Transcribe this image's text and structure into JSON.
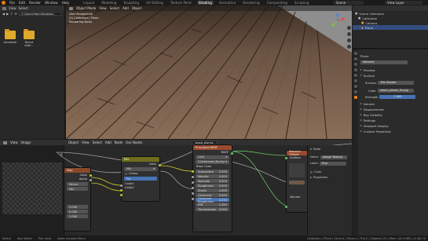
{
  "topbar": {
    "menus": [
      "File",
      "Edit",
      "Render",
      "Window",
      "Help"
    ],
    "workspaces": [
      "Layout",
      "Modeling",
      "Sculpting",
      "UV Editing",
      "Texture Paint",
      "Shading",
      "Animation",
      "Rendering",
      "Compositing",
      "Scripting"
    ],
    "active_workspace": "Shading",
    "scene": "Scene",
    "view_layer": "View Layer"
  },
  "filebrowser": {
    "menus": [
      "View",
      "Select"
    ],
    "path": "C:\\Users\\Yann\\Desktop\\",
    "folders": [
      "Autodesk",
      "Blend Addl..."
    ]
  },
  "viewport": {
    "menus": [
      "Object Mode",
      "View",
      "Select",
      "Add",
      "Object"
    ],
    "overlay_line1": "User Perspective",
    "overlay_line2": "(1) Collection | Plane",
    "overlay_line3": "Rendering Done"
  },
  "outliner": {
    "items": [
      "Scene Collection",
      "Collection",
      "Camera",
      "Plane"
    ]
  },
  "properties": {
    "breadcrumb": "Plane",
    "material_name": "Material",
    "sections": [
      "Preview",
      "Surface"
    ],
    "surface_label": "Surface",
    "surface_value": "Mix Shader",
    "color_label": "Color",
    "color_value": "wood_planks_0x.jpg",
    "strength_label": "Strength",
    "strength_value": "1.000",
    "collapsed": [
      "Volume",
      "Displacement",
      "Ray Visibility",
      "Settings",
      "Viewport Display",
      "Custom Properties"
    ]
  },
  "nodeeditor": {
    "menus": [
      "Object",
      "View",
      "Select",
      "Add",
      "Node",
      "Use Nodes"
    ],
    "material_field": "wood_planks",
    "img_menus": [
      "View",
      "Image"
    ],
    "img_values": [
      "2.000",
      "0.000",
      "1.000"
    ],
    "nodes": {
      "mix": {
        "title": "Mix",
        "out": "Color",
        "blend": "Mix",
        "clamp": "Clamp",
        "fac": "Fac",
        "in1": "Color1",
        "in2": "Color2"
      },
      "texture": {
        "title": "Texture",
        "out1": "Color",
        "out2": "Alpha"
      },
      "principled": {
        "title": "Principled BSDF",
        "out": "BSDF",
        "dist": "GGX",
        "sss": "Christensen-Burley",
        "rows": [
          {
            "label": "Base Color",
            "value": ""
          },
          {
            "label": "Subsurface",
            "value": "0.000"
          },
          {
            "label": "Metallic",
            "value": "0.000"
          },
          {
            "label": "Specular",
            "value": "0.500"
          },
          {
            "label": "Roughness",
            "value": "0.500"
          },
          {
            "label": "Sheen",
            "value": "0.000"
          },
          {
            "label": "Clearcoat",
            "value": "0.000"
          },
          {
            "label": "Clearcoat Roughness",
            "value": "0.030"
          },
          {
            "label": "IOR",
            "value": "1.450"
          },
          {
            "label": "Transmission",
            "value": "0.000"
          }
        ]
      },
      "output": {
        "title": "Material Output",
        "in1": "Surface",
        "in2": "Volume"
      },
      "partial": {
        "title": "Map",
        "rows": [
          "Vector",
          "Vec",
          "Rot"
        ]
      }
    },
    "npanel": {
      "section": "Node",
      "name_label": "Name",
      "name_value": "Image Texture",
      "label_label": "Label",
      "label_value": "Fine",
      "sub": "Color",
      "prop": "Properties"
    }
  },
  "statusbar": {
    "items": [
      "Select",
      "Box Select",
      "Pan View",
      "Node Context Menu"
    ],
    "stats": "Collection | Plane | Verts:4 | Faces:1 | Tris:2 | Objects:1/3 | Mem: 26.0 MiB | v2.80.75"
  },
  "colors": {
    "accent": "#e87d0d",
    "selection": "#334d80"
  }
}
